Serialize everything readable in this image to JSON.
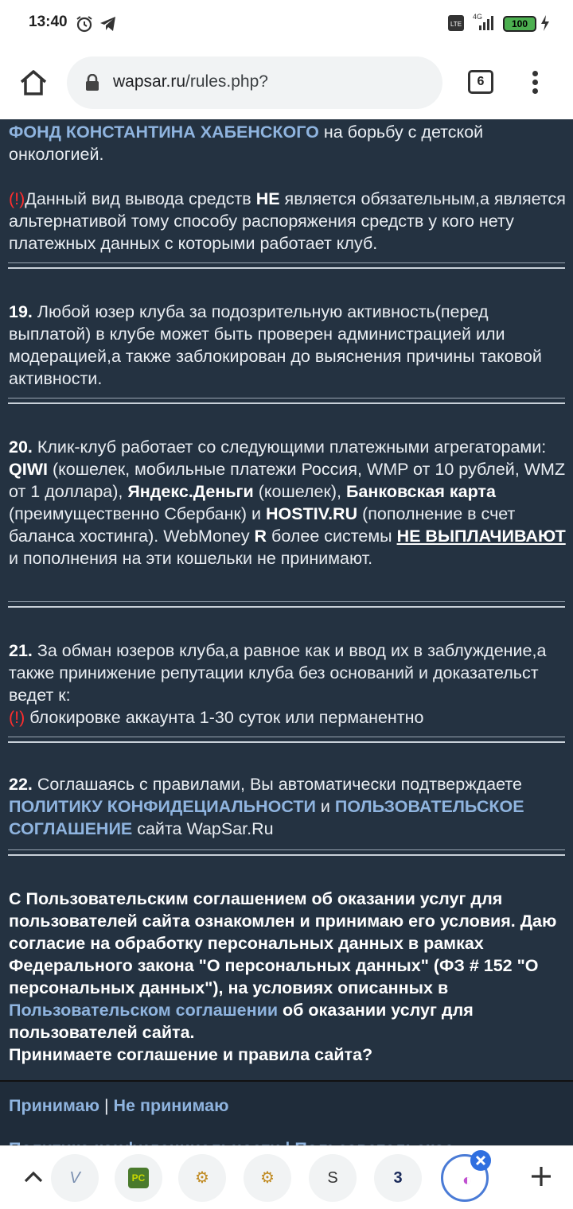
{
  "status_bar": {
    "time": "13:40",
    "network": "4G",
    "battery": "100"
  },
  "address_bar": {
    "url_host": "wapsar.ru",
    "url_path": "/rules.php?",
    "tab_count": "6"
  },
  "rules": {
    "p18_link": "ФОНД КОНСТАНТИНА ХАБЕНСКОГО",
    "p18_tail": "на борьбу с детской онкологией.",
    "p18_warn": "(!)",
    "p18_note_a": "Данный вид вывода средств ",
    "p18_note_b": "НЕ",
    "p18_note_c": " является обязательным,а является альтернативой тому способу распоряжения средств у кого нету платежных данных с которыми работает клуб.",
    "p19_num": "19.",
    "p19_text": " Любой юзер клуба за подозрительную активность(перед выплатой) в клубе может быть проверен администрацией или модерацией,а также заблокирован до выяснения причины таковой активности.",
    "p20_num": "20.",
    "p20_a": " Клик-клуб работает со следующими платежными агрегаторами: ",
    "p20_qiwi": "QIWI",
    "p20_b": " (кошелек, мобильные платежи Россия, WMP от 10 рублей, WMZ от 1 доллара), ",
    "p20_yandex": "Яндекс.Деньги",
    "p20_c": " (кошелек), ",
    "p20_bank": "Банковская карта",
    "p20_d": " (преимущественно Сбербанк) и ",
    "p20_hostiv": "HOSTIV.RU",
    "p20_e": " (пополнение в счет баланса хостинга). WebMoney ",
    "p20_r": "R",
    "p20_f": " более системы ",
    "p20_nopay": "НЕ ВЫПЛАЧИВАЮТ",
    "p20_g": " и пополнения на эти кошельки не принимают.",
    "p21_num": "21.",
    "p21_text": " За обман юзеров клуба,а равное как и ввод их в заблуждение,а также принижение репутации клуба без оснований и доказательст ведет к:",
    "p21_warn": "(!)",
    "p21_penalty": " блокировке аккаунта 1-30 суток или перманентно",
    "p22_num": "22.",
    "p22_a": " Соглашаясь с правилами, Вы автоматически подтверждаете ",
    "p22_privacy": "ПОЛИТИКУ КОНФИДЕЦИАЛЬНОСТИ",
    "p22_and": " и ",
    "p22_agreement": "ПОЛЬЗОВАТЕЛЬСКОЕ СОГЛАШЕНИЕ",
    "p22_b": " сайта WapSar.Ru"
  },
  "consent": {
    "text_a": "С Пользовательским соглашением об оказании услуг для пользователей сайта ознакомлен и принимаю его условия. Даю согласие на обработку персональных данных в рамках Федерального закона \"О персональных данных\" (ФЗ # 152 \"О персональных данных\"), на условиях описанных в ",
    "link": "Пользовательском соглашении",
    "text_b": " об оказании услуг для пользователей сайта.",
    "question": "Принимаете соглашение и правила сайта?"
  },
  "actions": {
    "accept": "Принимаю",
    "separator": "|",
    "decline": "Не принимаю",
    "footer_links": "Политика конфиденциальности | Пользовательское"
  },
  "bottom_bar": {
    "tab_icons": [
      "tab-v-icon",
      "tab-pc-icon",
      "tab-robot-icon",
      "tab-robot-icon",
      "tab-s-icon",
      "tab-3-icon",
      "tab-active-icon"
    ]
  }
}
